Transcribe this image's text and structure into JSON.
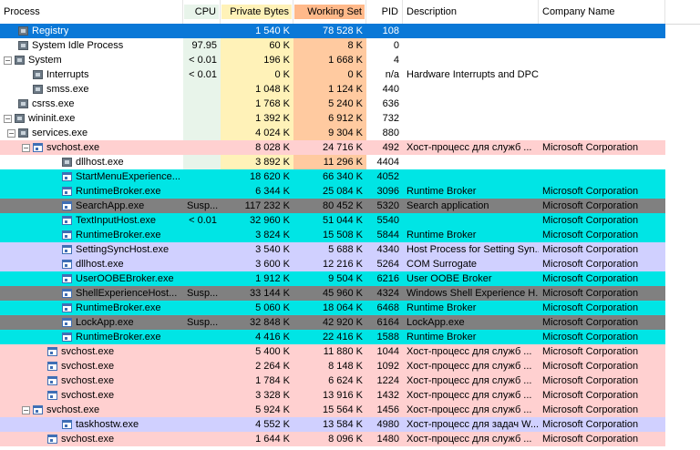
{
  "columns": {
    "process": "Process",
    "cpu": "CPU",
    "private_bytes": "Private Bytes",
    "working_set": "Working Set",
    "pid": "PID",
    "description": "Description",
    "company": "Company Name"
  },
  "colors": {
    "selected": "#0a78d7",
    "service": "#ffd0d0",
    "immersive": "#00e5e5",
    "suspended": "#808080",
    "own": "#d0d0ff",
    "cpu_band": "#e8f4ea",
    "private_band": "#fff2b8",
    "working_band": "#ffcaa0"
  },
  "rows": [
    {
      "name": "Registry",
      "indent": 1,
      "toggle": "",
      "icon": "sys",
      "cpu": "",
      "private": "1 540 K",
      "working": "78 528 K",
      "pid": "108",
      "desc": "",
      "company": "",
      "bg": "selected"
    },
    {
      "name": "System Idle Process",
      "indent": 1,
      "toggle": "",
      "icon": "sys",
      "cpu": "97.95",
      "private": "60 K",
      "working": "8 K",
      "pid": "0",
      "desc": "",
      "company": "",
      "bg": ""
    },
    {
      "name": "System",
      "indent": 0,
      "toggle": "−",
      "icon": "sys",
      "cpu": "< 0.01",
      "private": "196 K",
      "working": "1 668 K",
      "pid": "4",
      "desc": "",
      "company": "",
      "bg": ""
    },
    {
      "name": "Interrupts",
      "indent": 2,
      "toggle": "",
      "icon": "sys",
      "cpu": "< 0.01",
      "private": "0 K",
      "working": "0 K",
      "pid": "n/a",
      "desc": "Hardware Interrupts and DPCs",
      "company": "",
      "bg": ""
    },
    {
      "name": "smss.exe",
      "indent": 2,
      "toggle": "",
      "icon": "sys",
      "cpu": "",
      "private": "1 048 K",
      "working": "1 124 K",
      "pid": "440",
      "desc": "",
      "company": "",
      "bg": ""
    },
    {
      "name": "csrss.exe",
      "indent": 1,
      "toggle": "",
      "icon": "sys",
      "cpu": "",
      "private": "1 768 K",
      "working": "5 240 K",
      "pid": "636",
      "desc": "",
      "company": "",
      "bg": ""
    },
    {
      "name": "wininit.exe",
      "indent": 0,
      "toggle": "−",
      "icon": "sys",
      "cpu": "",
      "private": "1 392 K",
      "working": "6 912 K",
      "pid": "732",
      "desc": "",
      "company": "",
      "bg": ""
    },
    {
      "name": "services.exe",
      "indent": 1,
      "toggle": "−",
      "icon": "sys",
      "cpu": "",
      "private": "4 024 K",
      "working": "9 304 K",
      "pid": "880",
      "desc": "",
      "company": "",
      "bg": ""
    },
    {
      "name": "svchost.exe",
      "indent": 2,
      "toggle": "−",
      "icon": "win",
      "cpu": "",
      "private": "8 028 K",
      "working": "24 716 K",
      "pid": "492",
      "desc": "Хост-процесс для служб ...",
      "company": "Microsoft Corporation",
      "bg": "service"
    },
    {
      "name": "dllhost.exe",
      "indent": 4,
      "toggle": "",
      "icon": "sys",
      "cpu": "",
      "private": "3 892 K",
      "working": "11 296 K",
      "pid": "4404",
      "desc": "",
      "company": "",
      "bg": ""
    },
    {
      "name": "StartMenuExperience...",
      "indent": 4,
      "toggle": "",
      "icon": "win",
      "cpu": "",
      "private": "18 620 K",
      "working": "66 340 K",
      "pid": "4052",
      "desc": "",
      "company": "",
      "bg": "immersive"
    },
    {
      "name": "RuntimeBroker.exe",
      "indent": 4,
      "toggle": "",
      "icon": "win",
      "cpu": "",
      "private": "6 344 K",
      "working": "25 084 K",
      "pid": "3096",
      "desc": "Runtime Broker",
      "company": "Microsoft Corporation",
      "bg": "immersive"
    },
    {
      "name": "SearchApp.exe",
      "indent": 4,
      "toggle": "",
      "icon": "win",
      "cpu": "Susp...",
      "private": "117 232 K",
      "working": "80 452 K",
      "pid": "5320",
      "desc": "Search application",
      "company": "Microsoft Corporation",
      "bg": "suspended"
    },
    {
      "name": "TextInputHost.exe",
      "indent": 4,
      "toggle": "",
      "icon": "win",
      "cpu": "< 0.01",
      "private": "32 960 K",
      "working": "51 044 K",
      "pid": "5540",
      "desc": "",
      "company": "Microsoft Corporation",
      "bg": "immersive"
    },
    {
      "name": "RuntimeBroker.exe",
      "indent": 4,
      "toggle": "",
      "icon": "win",
      "cpu": "",
      "private": "3 824 K",
      "working": "15 508 K",
      "pid": "5844",
      "desc": "Runtime Broker",
      "company": "Microsoft Corporation",
      "bg": "immersive"
    },
    {
      "name": "SettingSyncHost.exe",
      "indent": 4,
      "toggle": "",
      "icon": "win",
      "cpu": "",
      "private": "3 540 K",
      "working": "5 688 K",
      "pid": "4340",
      "desc": "Host Process for Setting Syn...",
      "company": "Microsoft Corporation",
      "bg": "own"
    },
    {
      "name": "dllhost.exe",
      "indent": 4,
      "toggle": "",
      "icon": "win",
      "cpu": "",
      "private": "3 600 K",
      "working": "12 216 K",
      "pid": "5264",
      "desc": "COM Surrogate",
      "company": "Microsoft Corporation",
      "bg": "own"
    },
    {
      "name": "UserOOBEBroker.exe",
      "indent": 4,
      "toggle": "",
      "icon": "win",
      "cpu": "",
      "private": "1 912 K",
      "working": "9 504 K",
      "pid": "6216",
      "desc": "User OOBE Broker",
      "company": "Microsoft Corporation",
      "bg": "immersive"
    },
    {
      "name": "ShellExperienceHost...",
      "indent": 4,
      "toggle": "",
      "icon": "win",
      "cpu": "Susp...",
      "private": "33 144 K",
      "working": "45 960 K",
      "pid": "4324",
      "desc": "Windows Shell Experience H...",
      "company": "Microsoft Corporation",
      "bg": "suspended"
    },
    {
      "name": "RuntimeBroker.exe",
      "indent": 4,
      "toggle": "",
      "icon": "win",
      "cpu": "",
      "private": "5 060 K",
      "working": "18 064 K",
      "pid": "6468",
      "desc": "Runtime Broker",
      "company": "Microsoft Corporation",
      "bg": "immersive"
    },
    {
      "name": "LockApp.exe",
      "indent": 4,
      "toggle": "",
      "icon": "win",
      "cpu": "Susp...",
      "private": "32 848 K",
      "working": "42 920 K",
      "pid": "6164",
      "desc": "LockApp.exe",
      "company": "Microsoft Corporation",
      "bg": "suspended"
    },
    {
      "name": "RuntimeBroker.exe",
      "indent": 4,
      "toggle": "",
      "icon": "win",
      "cpu": "",
      "private": "4 416 K",
      "working": "22 416 K",
      "pid": "1588",
      "desc": "Runtime Broker",
      "company": "Microsoft Corporation",
      "bg": "immersive"
    },
    {
      "name": "svchost.exe",
      "indent": 3,
      "toggle": "",
      "icon": "win",
      "cpu": "",
      "private": "5 400 K",
      "working": "11 880 K",
      "pid": "1044",
      "desc": "Хост-процесс для служб ...",
      "company": "Microsoft Corporation",
      "bg": "service"
    },
    {
      "name": "svchost.exe",
      "indent": 3,
      "toggle": "",
      "icon": "win",
      "cpu": "",
      "private": "2 264 K",
      "working": "8 148 K",
      "pid": "1092",
      "desc": "Хост-процесс для служб ...",
      "company": "Microsoft Corporation",
      "bg": "service"
    },
    {
      "name": "svchost.exe",
      "indent": 3,
      "toggle": "",
      "icon": "win",
      "cpu": "",
      "private": "1 784 K",
      "working": "6 624 K",
      "pid": "1224",
      "desc": "Хост-процесс для служб ...",
      "company": "Microsoft Corporation",
      "bg": "service"
    },
    {
      "name": "svchost.exe",
      "indent": 3,
      "toggle": "",
      "icon": "win",
      "cpu": "",
      "private": "3 328 K",
      "working": "13 916 K",
      "pid": "1432",
      "desc": "Хост-процесс для служб ...",
      "company": "Microsoft Corporation",
      "bg": "service"
    },
    {
      "name": "svchost.exe",
      "indent": 2,
      "toggle": "−",
      "icon": "win",
      "cpu": "",
      "private": "5 924 K",
      "working": "15 564 K",
      "pid": "1456",
      "desc": "Хост-процесс для служб ...",
      "company": "Microsoft Corporation",
      "bg": "service"
    },
    {
      "name": "taskhostw.exe",
      "indent": 4,
      "toggle": "",
      "icon": "win",
      "cpu": "",
      "private": "4 552 K",
      "working": "13 584 K",
      "pid": "4980",
      "desc": "Хост-процесс для задач W...",
      "company": "Microsoft Corporation",
      "bg": "own"
    },
    {
      "name": "svchost.exe",
      "indent": 3,
      "toggle": "",
      "icon": "win",
      "cpu": "",
      "private": "1 644 K",
      "working": "8 096 K",
      "pid": "1480",
      "desc": "Хост-процесс для служб ...",
      "company": "Microsoft Corporation",
      "bg": "service"
    }
  ]
}
